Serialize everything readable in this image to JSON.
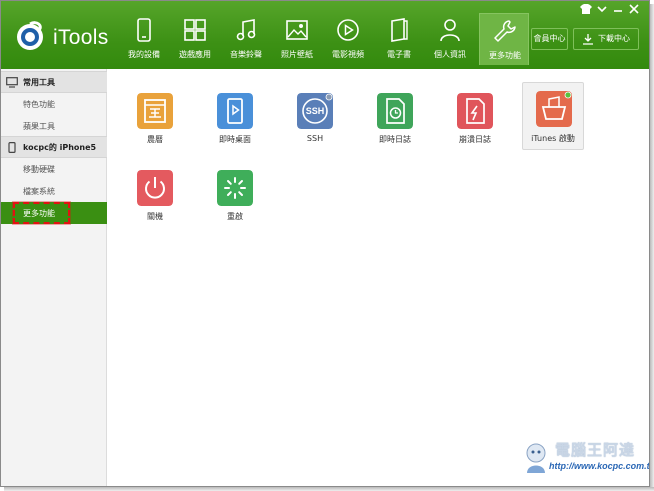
{
  "app": {
    "title": "iTools",
    "member_center": "會員中心",
    "download_center": "下載中心"
  },
  "nav": [
    {
      "label": "我的設備",
      "icon": "phone-icon"
    },
    {
      "label": "遊戲應用",
      "icon": "apps-grid-icon"
    },
    {
      "label": "音樂鈴聲",
      "icon": "music-note-icon"
    },
    {
      "label": "照片壁紙",
      "icon": "photo-icon"
    },
    {
      "label": "電影視頻",
      "icon": "play-icon"
    },
    {
      "label": "電子書",
      "icon": "book-icon"
    },
    {
      "label": "個人資訊",
      "icon": "person-icon"
    },
    {
      "label": "更多功能",
      "icon": "wrench-icon",
      "active": true
    }
  ],
  "sidebar": {
    "section1": {
      "label": "常用工具"
    },
    "section1_items": [
      {
        "label": "特色功能"
      },
      {
        "label": "蘋果工具"
      }
    ],
    "section2": {
      "label": "kocpc的 iPhone5"
    },
    "section2_items": [
      {
        "label": "移動硬碟"
      },
      {
        "label": "檔案系統"
      },
      {
        "label": "更多功能",
        "active": true
      }
    ]
  },
  "tools": [
    {
      "label": "農曆",
      "icon": "calendar-icon",
      "color": "#e9a23b"
    },
    {
      "label": "即時桌面",
      "icon": "desktop-play-icon",
      "color": "#4a90d9"
    },
    {
      "label": "SSH",
      "icon": "ssh-icon",
      "color": "#5a7fb8"
    },
    {
      "label": "即時日誌",
      "icon": "log-clock-icon",
      "color": "#3fa55a"
    },
    {
      "label": "崩潰日誌",
      "icon": "crash-log-icon",
      "color": "#e0555b"
    },
    {
      "label": "iTunes 啟動",
      "icon": "itunes-basket-icon",
      "color": "#e46a4c"
    },
    {
      "label": "關機",
      "icon": "power-icon",
      "color": "#e45a5f"
    },
    {
      "label": "重啟",
      "icon": "restart-icon",
      "color": "#3fae5a"
    }
  ],
  "watermark": {
    "title": "電腦王阿達",
    "url": "http://www.kocpc.com.tw"
  },
  "colors": {
    "header_green": "#3d9115",
    "active_green": "#3a8f12",
    "highlight_red": "#e21212"
  }
}
